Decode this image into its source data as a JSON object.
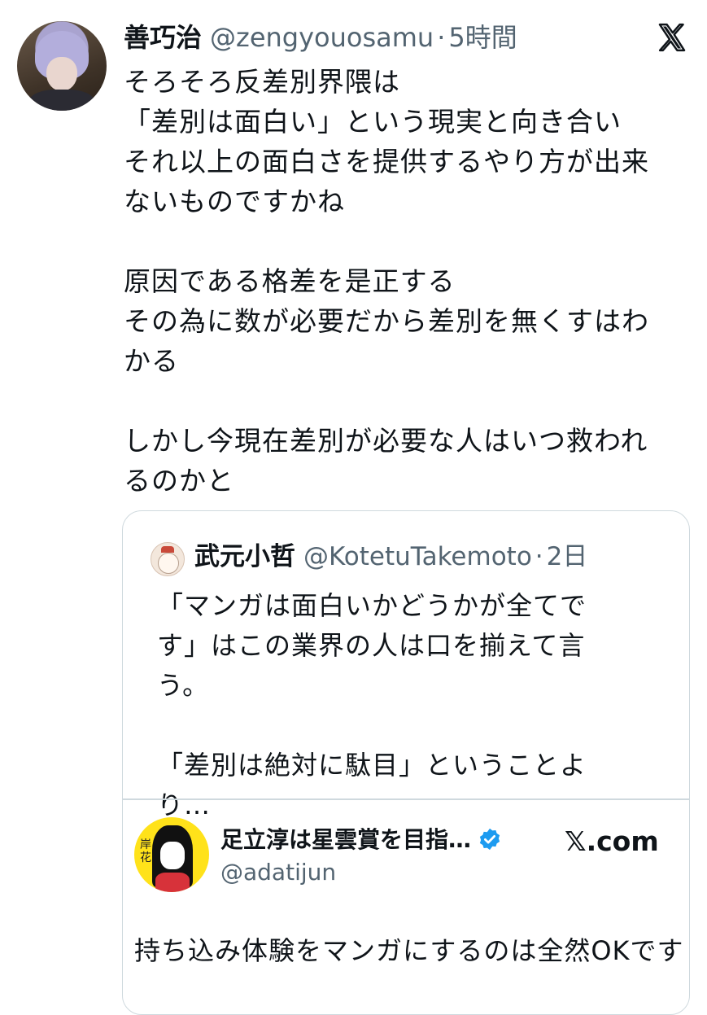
{
  "tweet": {
    "author_name": "善巧治",
    "author_handle": "@zengyouosamu",
    "separator": "·",
    "time": "5時間",
    "text": "そろそろ反差別界隈は\n「差別は面白い」という現実と向き合い\nそれ以上の面白さを提供するやり方が出来\nないものですかね\n\n原因である格差を是正する\nその為に数が必要だから差別を無くすはわ\nかる\n\nしかし今現在差別が必要な人はいつ救われ\nるのかと"
  },
  "quoted_tweet": {
    "author_name": "武元小哲",
    "author_handle": "@KotetuTakemoto",
    "separator": "·",
    "time": "2日",
    "text": "「マンガは面白いかどうかが全てで\nす」はこの業界の人は口を揃えて言\nう。\n\n「差別は絶対に駄目」ということより…"
  },
  "embedded_card": {
    "author_name": "足立淳は星雲賞を目指…",
    "author_handle": "@adatijun",
    "site": "𝕏.com",
    "avatar_text": "岸花",
    "text": "持ち込み体験をマンガにするのは全然OKです"
  },
  "icons": {
    "platform_logo": "x-logo-icon",
    "verified_badge": "verified-badge-icon",
    "verified_color": "#1d9bf0"
  }
}
